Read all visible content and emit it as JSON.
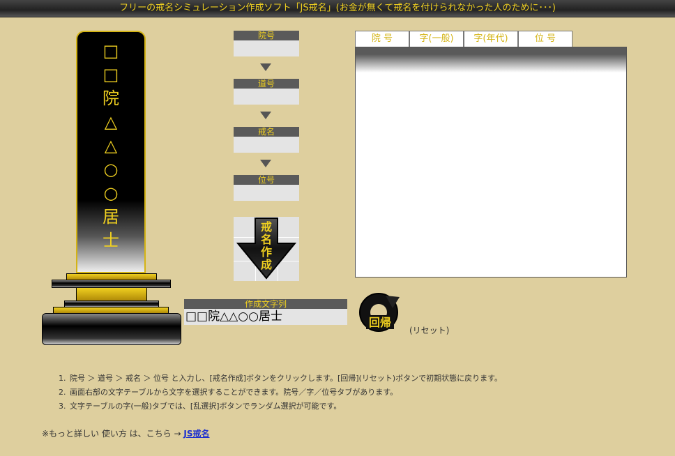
{
  "app": {
    "title": "フリーの戒名シミュレーション作成ソフト「JS戒名」(お金が無くて戒名を付けられなかった人のために･･･)"
  },
  "tablet": {
    "lines": [
      "□",
      "□",
      "院",
      "△",
      "△",
      "○",
      "○",
      "居",
      "士"
    ]
  },
  "steps": {
    "ingou_label": "院号",
    "dougou_label": "道号",
    "kaimyou_label": "戒名",
    "igou_label": "位号",
    "ingou_value": "",
    "dougou_value": "",
    "kaimyou_value": "",
    "igou_value": ""
  },
  "create_button": {
    "label": "戒名作成"
  },
  "result": {
    "label": "作成文字列",
    "value": "□□院△△○○居士"
  },
  "reset": {
    "label": "回帰",
    "caption": "(リセット)"
  },
  "tabs": [
    {
      "label": "院 号"
    },
    {
      "label": "字(一般)"
    },
    {
      "label": "字(年代)"
    },
    {
      "label": "位 号"
    }
  ],
  "instructions": [
    "院号 ＞ 道号 ＞ 戒名 ＞ 位号 と入力し、[戒名作成]ボタンをクリックします。[回帰](リセット)ボタンで初期状態に戻ります。",
    "画面右部の文字テーブルから文字を選択することができます。院号／字／位号タブがあります。",
    "文字テーブルの字(一般)タブでは、[乱選択]ボタンでランダム選択が可能です。"
  ],
  "footer": {
    "text": "※もっと詳しい 使い方 は、こちら →",
    "link": "JS戒名"
  },
  "colors": {
    "background": "#decf9e",
    "accent_gold": "#f0d020",
    "label_gray": "#5a5a5a"
  }
}
